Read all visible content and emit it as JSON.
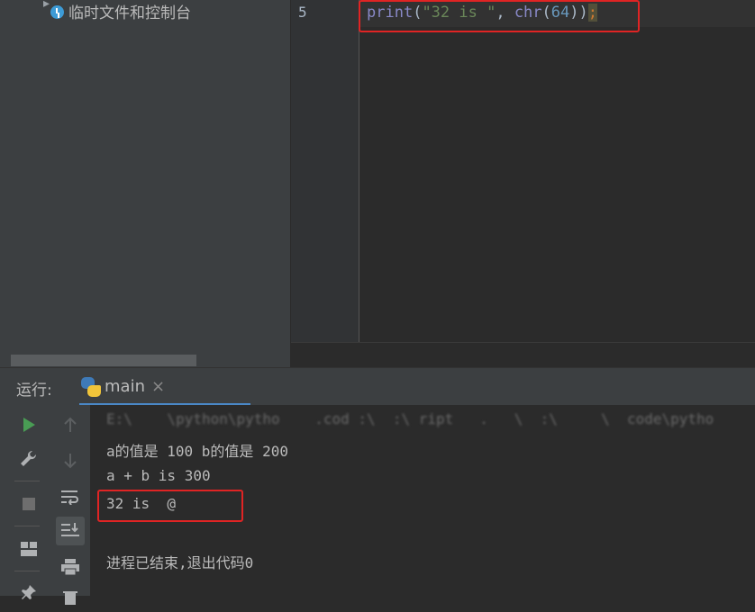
{
  "project_tree": {
    "scratches_label": "临时文件和控制台"
  },
  "editor": {
    "line_number": "5",
    "code": {
      "fn": "print",
      "open": "(",
      "str": "\"32 is \"",
      "comma": ", ",
      "fn2": "chr",
      "open2": "(",
      "num": "64",
      "close": "))",
      "semi": ";"
    }
  },
  "run_panel": {
    "label": "运行:",
    "tab_title": "main",
    "tab_close": "×",
    "console_lines": [
      "E:\\    \\python\\pytho    .cod :\\  :\\ ript   .   \\  :\\     \\  code\\pytho",
      "a的值是 100 b的值是 200",
      "a + b is 300",
      "32 is  @",
      "",
      "进程已结束,退出代码0"
    ]
  },
  "icons": {
    "run": "run-icon",
    "wrench": "wrench-icon",
    "stop": "stop-icon",
    "layout": "layout-icon",
    "pin": "pin-icon",
    "up": "arrow-up-icon",
    "down": "arrow-down-icon",
    "wrap": "soft-wrap-icon",
    "scroll_end": "scroll-to-end-icon",
    "print": "print-icon",
    "delete": "delete-icon"
  },
  "colors": {
    "highlight_box": "#e02424",
    "run_green": "#499c54"
  }
}
